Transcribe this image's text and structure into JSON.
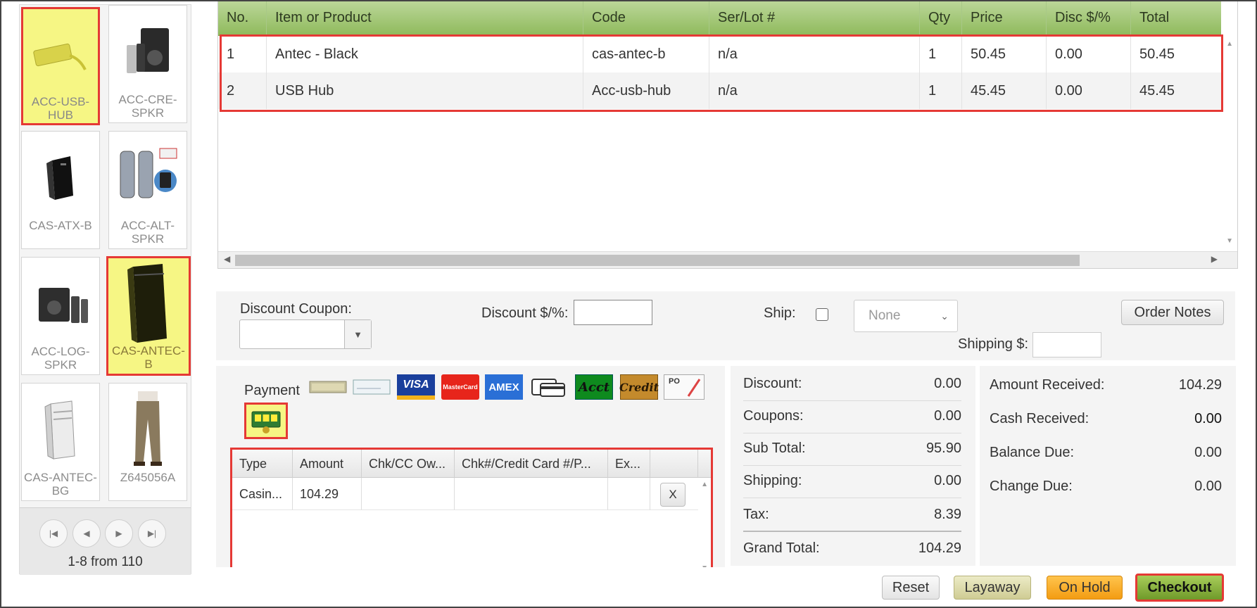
{
  "products": [
    {
      "label": "ACC-USB-HUB",
      "icon": "usb-hub-icon",
      "selected": true
    },
    {
      "label": "ACC-CRE-SPKR",
      "icon": "speakers-icon",
      "selected": false
    },
    {
      "label": "CAS-ATX-B",
      "icon": "pc-case-icon",
      "selected": false
    },
    {
      "label": "ACC-ALT-SPKR",
      "icon": "speakers-icon",
      "selected": false
    },
    {
      "label": "ACC-LOG-SPKR",
      "icon": "speakers-icon",
      "selected": false
    },
    {
      "label": "CAS-ANTEC-B",
      "icon": "pc-tower-icon",
      "selected": true
    },
    {
      "label": "CAS-ANTEC-BG",
      "icon": "pc-case-icon",
      "selected": false
    },
    {
      "label": "Z645056A",
      "icon": "pants-icon",
      "selected": false
    }
  ],
  "pager": {
    "info": "1-8 from 110"
  },
  "items_grid": {
    "headers": [
      "No.",
      "Item or Product",
      "Code",
      "Ser/Lot #",
      "Qty",
      "Price",
      "Disc $/%",
      "Total"
    ],
    "rows": [
      [
        "1",
        "Antec - Black",
        "cas-antec-b",
        "n/a",
        "1",
        "50.45",
        "0.00",
        "50.45"
      ],
      [
        "2",
        "USB Hub",
        "Acc-usb-hub",
        "n/a",
        "1",
        "45.45",
        "0.00",
        "45.45"
      ]
    ]
  },
  "options": {
    "coupon_label": "Discount Coupon:",
    "discount_label": "Discount $/%:",
    "ship_label": "Ship:",
    "ship_select": "None",
    "shipping_label": "Shipping $:",
    "order_notes": "Order Notes"
  },
  "payment": {
    "title": "Payment",
    "methods": [
      "cash-icon",
      "check-icon",
      "visa-icon",
      "mastercard-icon",
      "amex-icon",
      "card-icon",
      "account-icon",
      "credit-icon",
      "po-icon",
      "casino-icon"
    ],
    "method_texts": {
      "visa": "VISA",
      "mastercard": "MasterCard",
      "amex": "AMEX",
      "acct": "Acct",
      "credit": "Credit",
      "po": "PO"
    },
    "table_headers": [
      "Type",
      "Amount",
      "Chk/CC Ow...",
      "Chk#/Credit Card #/P...",
      "Ex..."
    ],
    "rows": [
      {
        "type": "Casin...",
        "amount": "104.29",
        "owner": "",
        "number": "",
        "exp": "",
        "remove": "X"
      }
    ]
  },
  "totals": {
    "discount": {
      "label": "Discount:",
      "value": "0.00"
    },
    "coupons": {
      "label": "Coupons:",
      "value": "0.00"
    },
    "subtotal": {
      "label": "Sub Total:",
      "value": "95.90"
    },
    "shipping": {
      "label": "Shipping:",
      "value": "0.00"
    },
    "tax": {
      "label": "Tax:",
      "value": "8.39"
    },
    "grand": {
      "label": "Grand Total:",
      "value": "104.29"
    }
  },
  "amounts": {
    "received": {
      "label": "Amount Received:",
      "value": "104.29"
    },
    "cash": {
      "label": "Cash Received:",
      "value": "0.00"
    },
    "balance": {
      "label": "Balance Due:",
      "value": "0.00"
    },
    "change": {
      "label": "Change Due:",
      "value": "0.00"
    }
  },
  "actions": {
    "reset": "Reset",
    "layaway": "Layaway",
    "on_hold": "On Hold",
    "checkout": "Checkout"
  },
  "colors": {
    "accent_green": "#8fba5c",
    "highlight_red": "#e53935",
    "selected_yellow": "#f6f684",
    "onhold_orange": "#f5a623",
    "checkout_green": "#7ea33a"
  }
}
